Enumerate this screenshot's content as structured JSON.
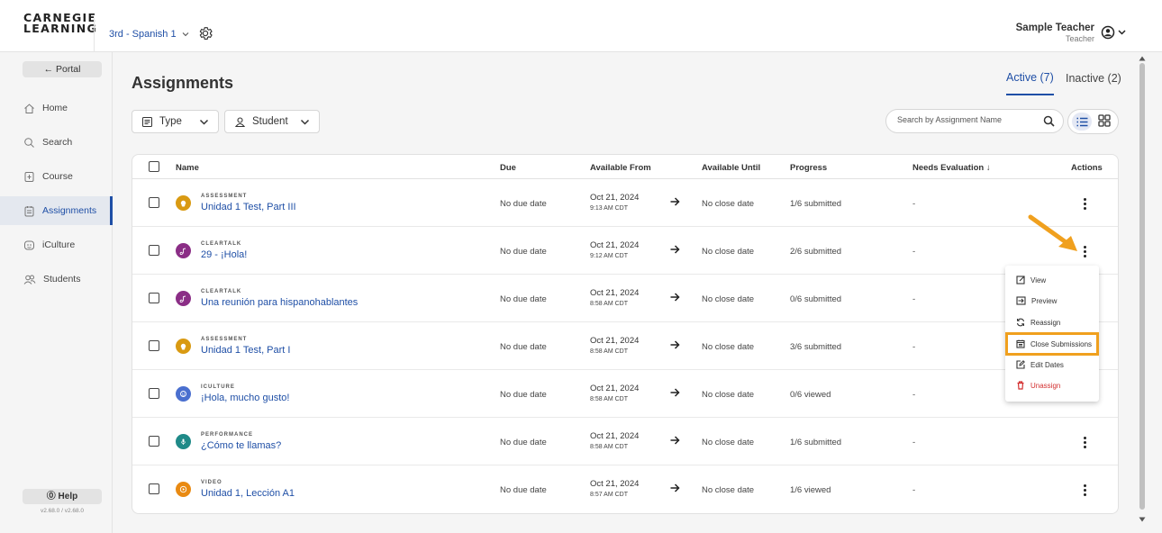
{
  "header": {
    "logo_line1": "CARNEGIE",
    "logo_line2": "LEARNING",
    "course": "3rd - Spanish 1",
    "user_name": "Sample Teacher",
    "user_role": "Teacher"
  },
  "sidebar": {
    "portal": "← Portal",
    "items": [
      {
        "label": "Home",
        "icon": "home-icon"
      },
      {
        "label": "Search",
        "icon": "search-icon"
      },
      {
        "label": "Course",
        "icon": "course-icon"
      },
      {
        "label": "Assignments",
        "icon": "assignments-icon"
      },
      {
        "label": "iCulture",
        "icon": "iculture-icon"
      },
      {
        "label": "Students",
        "icon": "students-icon"
      }
    ],
    "help": "⓪ Help",
    "version": "v2.68.0 / v2.68.0"
  },
  "main": {
    "title": "Assignments",
    "tab_active": "Active (7)",
    "tab_inactive": "Inactive (2)",
    "filter_type": "Type",
    "filter_student": "Student",
    "search_placeholder": "Search by Assignment Name"
  },
  "table": {
    "headers": {
      "name": "Name",
      "due": "Due",
      "available_from": "Available From",
      "available_until": "Available Until",
      "progress": "Progress",
      "needs_evaluation": "Needs Evaluation ↓",
      "actions": "Actions"
    },
    "rows": [
      {
        "type": "ASSESSMENT",
        "name": "Unidad 1 Test, Part III",
        "due": "No due date",
        "from_date": "Oct 21, 2024",
        "from_time": "9:13 AM CDT",
        "until": "No close date",
        "progress": "1/6 submitted",
        "needs_eval": "-",
        "icon_color": "#d99a12",
        "icon": "lightbulb-icon"
      },
      {
        "type": "CLEARTALK",
        "name": "29 - ¡Hola!",
        "due": "No due date",
        "from_date": "Oct 21, 2024",
        "from_time": "9:12 AM CDT",
        "until": "No close date",
        "progress": "2/6 submitted",
        "needs_eval": "-",
        "icon_color": "#8b2e86",
        "icon": "music-icon"
      },
      {
        "type": "CLEARTALK",
        "name": "Una reunión para hispanohablantes",
        "due": "No due date",
        "from_date": "Oct 21, 2024",
        "from_time": "8:58 AM CDT",
        "until": "No close date",
        "progress": "0/6 submitted",
        "needs_eval": "-",
        "icon_color": "#8b2e86",
        "icon": "music-icon"
      },
      {
        "type": "ASSESSMENT",
        "name": "Unidad 1 Test, Part I",
        "due": "No due date",
        "from_date": "Oct 21, 2024",
        "from_time": "8:58 AM CDT",
        "until": "No close date",
        "progress": "3/6 submitted",
        "needs_eval": "-",
        "icon_color": "#d99a12",
        "icon": "lightbulb-icon"
      },
      {
        "type": "ICULTURE",
        "name": "¡Hola, mucho gusto!",
        "due": "No due date",
        "from_date": "Oct 21, 2024",
        "from_time": "8:58 AM CDT",
        "until": "No close date",
        "progress": "0/6 viewed",
        "needs_eval": "-",
        "icon_color": "#4a6fcf",
        "icon": "globe-icon"
      },
      {
        "type": "PERFORMANCE",
        "name": "¿Cómo te llamas?",
        "due": "No due date",
        "from_date": "Oct 21, 2024",
        "from_time": "8:58 AM CDT",
        "until": "No close date",
        "progress": "1/6 submitted",
        "needs_eval": "-",
        "icon_color": "#1f8a88",
        "icon": "microphone-icon"
      },
      {
        "type": "VIDEO",
        "name": "Unidad 1, Lección A1",
        "due": "No due date",
        "from_date": "Oct 21, 2024",
        "from_time": "8:57 AM CDT",
        "until": "No close date",
        "progress": "1/6 viewed",
        "needs_eval": "-",
        "icon_color": "#e98a12",
        "icon": "play-icon"
      }
    ]
  },
  "menu": {
    "items": [
      {
        "label": "View",
        "icon": "external-link-icon"
      },
      {
        "label": "Preview",
        "icon": "preview-icon"
      },
      {
        "label": "Reassign",
        "icon": "refresh-icon"
      },
      {
        "label": "Close Submissions",
        "icon": "calendar-close-icon"
      },
      {
        "label": "Edit Dates",
        "icon": "edit-icon"
      },
      {
        "label": "Unassign",
        "icon": "trash-icon"
      }
    ]
  },
  "colors": {
    "accent": "#1f4fa6",
    "highlight": "#f0a01e",
    "danger": "#d32f2f"
  }
}
